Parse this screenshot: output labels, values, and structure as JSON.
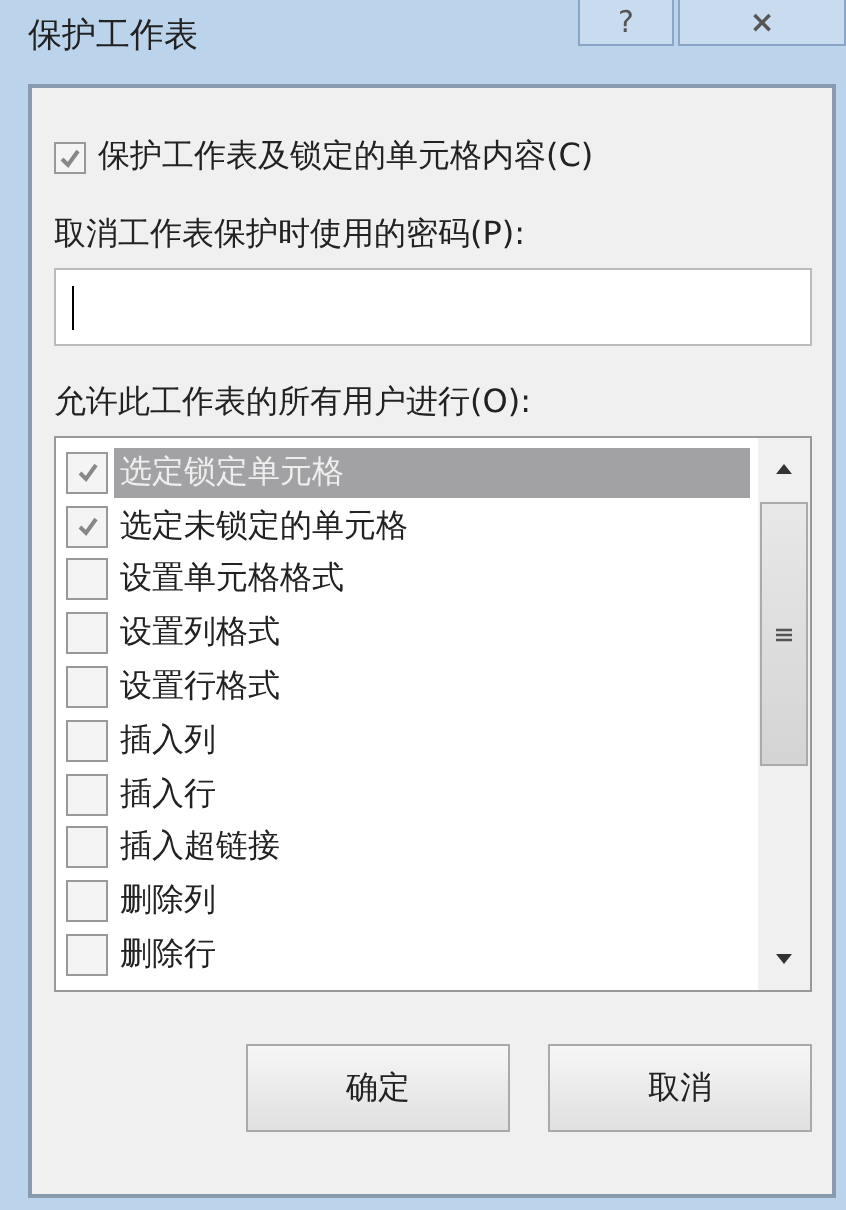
{
  "window": {
    "title": "保护工作表",
    "buttons": [
      {
        "kind": "help",
        "label": "?"
      },
      {
        "kind": "close",
        "label": "×"
      }
    ]
  },
  "protect": {
    "label": "保护工作表及锁定的单元格内容(C)",
    "checked": true
  },
  "password": {
    "label": "取消工作表保护时使用的密码(P):"
  },
  "permissions": {
    "label": "允许此工作表的所有用户进行(O):",
    "items": [
      {
        "label": "选定锁定单元格",
        "checked": true,
        "selected": true
      },
      {
        "label": "选定未锁定的单元格",
        "checked": true,
        "selected": false
      },
      {
        "label": "设置单元格格式",
        "checked": false,
        "selected": false
      },
      {
        "label": "设置列格式",
        "checked": false,
        "selected": false
      },
      {
        "label": "设置行格式",
        "checked": false,
        "selected": false
      },
      {
        "label": "插入列",
        "checked": false,
        "selected": false
      },
      {
        "label": "插入行",
        "checked": false,
        "selected": false
      },
      {
        "label": "插入超链接",
        "checked": false,
        "selected": false
      },
      {
        "label": "删除列",
        "checked": false,
        "selected": false
      },
      {
        "label": "删除行",
        "checked": false,
        "selected": false
      }
    ]
  },
  "buttons": [
    {
      "label": "确定"
    },
    {
      "label": "取消"
    }
  ]
}
